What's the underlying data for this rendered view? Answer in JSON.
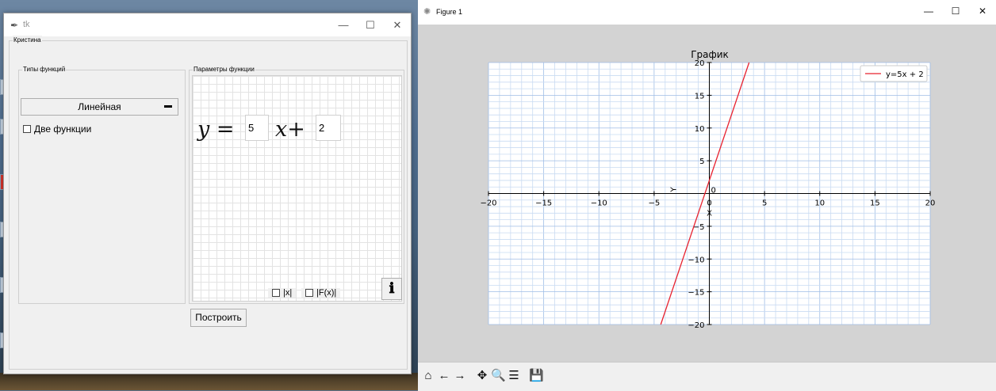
{
  "tk_window": {
    "title": "tk",
    "controls": {
      "minimize": "—",
      "maximize": "☐",
      "close": "✕"
    },
    "main_group_label": "Кристина",
    "function_types": {
      "group_label": "Типы функций",
      "selected_type": "Линейная",
      "two_functions_label": "Две функции",
      "two_functions_checked": false
    },
    "function_params": {
      "group_label": "Параметры функции",
      "y_label": "y =",
      "x_label": "x+",
      "a_value": "5",
      "b_value": "2",
      "abs_x_label": "|x|",
      "abs_fx_label": "|F(x)|",
      "info_icon": "info-icon"
    },
    "build_button": "Построить"
  },
  "figure_window": {
    "title": "Figure 1",
    "controls": {
      "minimize": "—",
      "maximize": "☐",
      "close": "✕"
    },
    "toolbar": [
      {
        "name": "home-icon",
        "glyph": "⌂"
      },
      {
        "name": "back-icon",
        "glyph": "←"
      },
      {
        "name": "forward-icon",
        "glyph": "→"
      },
      {
        "name": "pan-icon",
        "glyph": "✥"
      },
      {
        "name": "zoom-icon",
        "glyph": "🔍"
      },
      {
        "name": "configure-icon",
        "glyph": "☰"
      },
      {
        "name": "save-icon",
        "glyph": "💾"
      }
    ]
  },
  "chart_data": {
    "type": "line",
    "title": "График",
    "xlabel": "X",
    "ylabel": "Y",
    "xlim": [
      -20,
      20
    ],
    "ylim": [
      -20,
      20
    ],
    "xticks": [
      -20,
      -15,
      -10,
      -5,
      0,
      5,
      10,
      15,
      20
    ],
    "yticks": [
      -20,
      -15,
      -10,
      -5,
      0,
      5,
      10,
      15,
      20
    ],
    "xtick_labels": [
      "−20",
      "−15",
      "−10",
      "−5",
      "0",
      "5",
      "10",
      "15",
      "20"
    ],
    "ytick_labels": [
      "−20",
      "−15",
      "−10",
      "−5",
      "0",
      "5",
      "10",
      "15",
      "20"
    ],
    "grid": true,
    "legend_position": "top-right",
    "series": [
      {
        "name": "y=5x + 2",
        "color": "#e8222f",
        "x": [
          -4.4,
          3.6
        ],
        "y": [
          -20,
          20
        ]
      }
    ]
  }
}
